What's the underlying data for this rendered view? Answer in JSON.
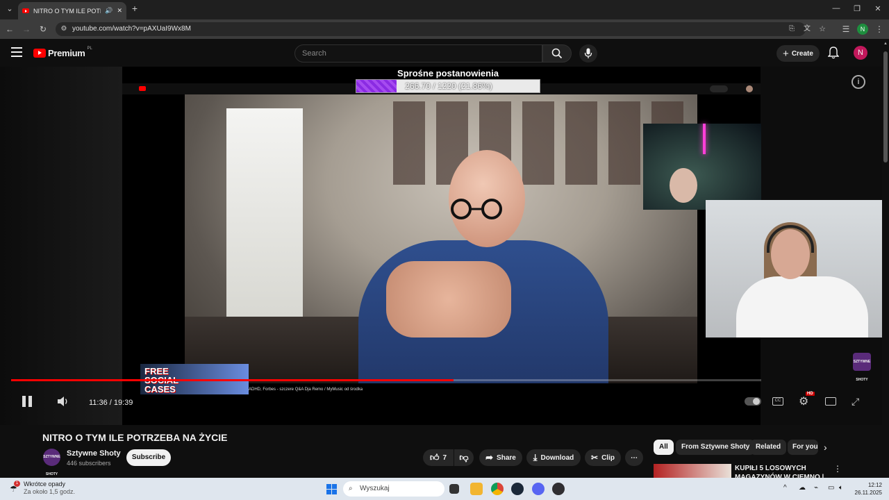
{
  "browser": {
    "tab_title": "NITRO O TYM ILE POTRZEB",
    "url": "youtube.com/watch?v=pAXUaI9Wx8M",
    "profile_initial": "N"
  },
  "masthead": {
    "logo_text": "Premium",
    "logo_region": "PL",
    "search_placeholder": "Search",
    "create_label": "Create",
    "avatar_initial": "N"
  },
  "player": {
    "goal_title": "Sprośne postanowienia",
    "goal_text": "266.70 / 1220 (21.86%)",
    "goal_progress": 0.2186,
    "free_cases_line1": "FREE",
    "free_cases_line2": "SOCIAL",
    "free_cases_line3": "CASES",
    "inner_caption": "ADHD, Forbes - szczere Q&A Dja Remo / MyMusic od środka",
    "current_time": "11:36",
    "duration": "19:39",
    "time_display": "11:36 / 19:39",
    "watched_fraction": 0.59,
    "hd_badge": "HD"
  },
  "video": {
    "title": "NITRO O TYM ILE POTRZEBA NA ŻYCIE",
    "channel_name": "Sztywne Shoty",
    "subscribers": "446 subscribers",
    "channel_avatar_text": "SZTYWNE SHOTY",
    "subscribe_label": "Subscribe",
    "like_count": "7",
    "share_label": "Share",
    "download_label": "Download",
    "clip_label": "Clip"
  },
  "sidebar": {
    "chips": [
      "All",
      "From Sztywne Shoty",
      "Related",
      "For you"
    ],
    "rec_title": "KUPIŁI 5 LOSOWYCH MAGAZYNÓW W CIEMNO |"
  },
  "taskbar": {
    "weather_line1": "Wkrótce opady",
    "weather_line2": "Za około 1,5 godz.",
    "search_placeholder": "Wyszukaj",
    "time": "12:12",
    "date": "26.11.2025",
    "notification_count": "1"
  },
  "colors": {
    "yt_red": "#ff0000",
    "bg": "#0f0f0f",
    "goal_purple": "#8a2be2",
    "avatar_pink": "#c2185b"
  }
}
